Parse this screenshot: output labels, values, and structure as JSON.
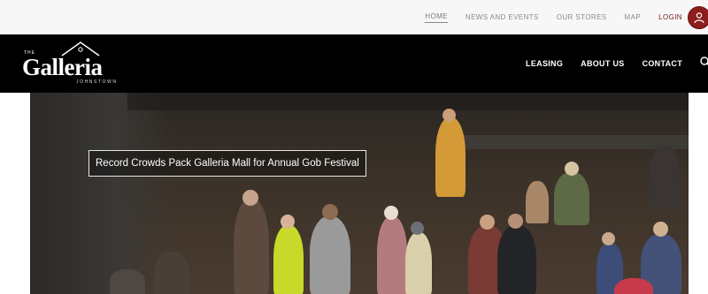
{
  "top_nav": {
    "items": [
      "HOME",
      "NEWS AND EVENTS",
      "OUR STORES",
      "MAP"
    ],
    "login": "LOGIN",
    "active": "HOME"
  },
  "logo": {
    "the": "THE",
    "name": "Galleria",
    "location": "JOHNSTOWN"
  },
  "main_nav": {
    "items": [
      "LEASING",
      "ABOUT US",
      "CONTACT"
    ]
  },
  "hero": {
    "headline": "Record Crowds Pack Galleria Mall for Annual Gob Festival"
  },
  "colors": {
    "accent": "#8c1e1e",
    "header_bg": "#000000",
    "topbar_bg": "#f7f7f7"
  },
  "icons": [
    "user-icon",
    "search-icon",
    "house-roof-icon"
  ]
}
